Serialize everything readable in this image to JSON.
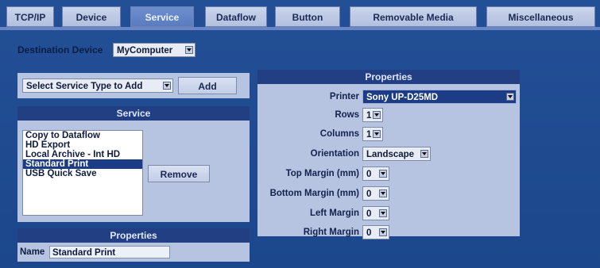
{
  "tabs": [
    {
      "label": "TCP/IP"
    },
    {
      "label": "Device"
    },
    {
      "label": "Service"
    },
    {
      "label": "Dataflow"
    },
    {
      "label": "Button"
    },
    {
      "label": "Removable Media"
    },
    {
      "label": "Miscellaneous"
    }
  ],
  "active_tab": "Service",
  "destination": {
    "label": "Destination Device",
    "value": "MyComputer"
  },
  "service_type": {
    "value": "Select Service Type to Add",
    "add_label": "Add"
  },
  "service_panel": {
    "title": "Service",
    "items": [
      "Copy to Dataflow",
      "HD Export",
      "Local Archive - Int HD",
      "Standard Print",
      "USB Quick Save"
    ],
    "selected": "Standard Print",
    "remove_label": "Remove"
  },
  "lower_properties": {
    "title": "Properties",
    "name_label": "Name",
    "name_value": "Standard Print"
  },
  "properties": {
    "title": "Properties",
    "fields": [
      {
        "label": "Printer",
        "value": "Sony UP-D25MD"
      },
      {
        "label": "Rows",
        "value": "1"
      },
      {
        "label": "Columns",
        "value": "1"
      },
      {
        "label": "Orientation",
        "value": "Landscape"
      },
      {
        "label": "Top Margin (mm)",
        "value": "0"
      },
      {
        "label": "Bottom Margin (mm)",
        "value": "0"
      },
      {
        "label": "Left Margin",
        "value": "0"
      },
      {
        "label": "Right Margin",
        "value": "0"
      }
    ]
  },
  "colors": {
    "background": "#1f4d93",
    "panel": "#b6c4e2",
    "header": "#223f84",
    "selected": "#1d3c88"
  }
}
